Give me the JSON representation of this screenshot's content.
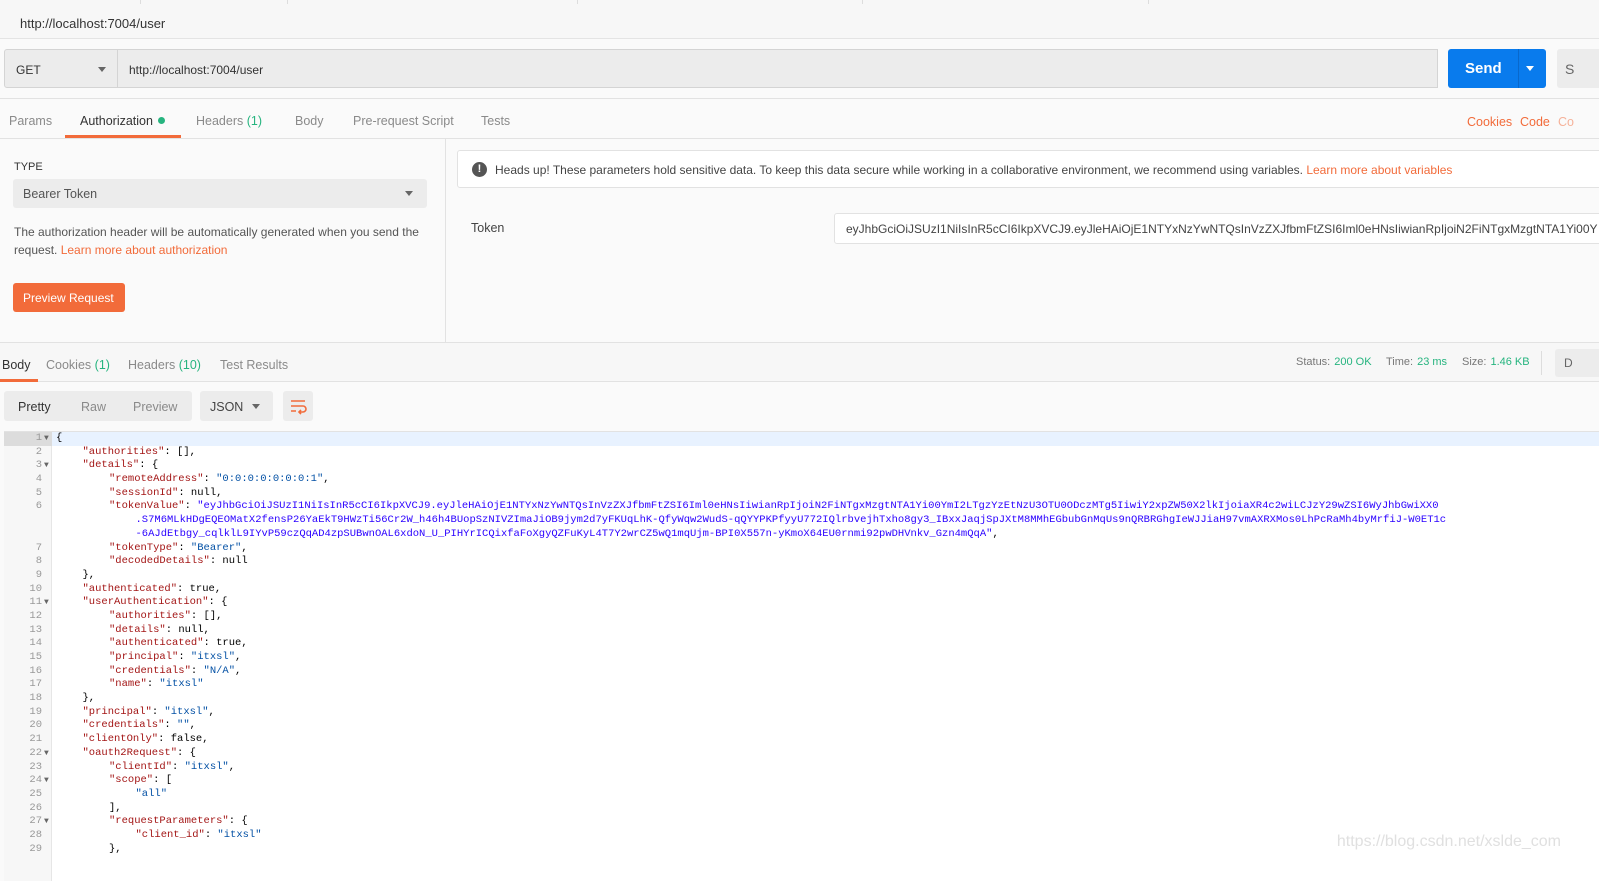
{
  "window": {
    "title": "http://localhost:7004/user"
  },
  "request": {
    "method": "GET",
    "url": "http://localhost:7004/user",
    "send_label": "Send",
    "save_label": "S"
  },
  "request_tabs": [
    {
      "label": "Params"
    },
    {
      "label": "Authorization",
      "active": true,
      "dot": true
    },
    {
      "label": "Headers",
      "count": "(1)"
    },
    {
      "label": "Body"
    },
    {
      "label": "Pre-request Script"
    },
    {
      "label": "Tests"
    }
  ],
  "request_links": {
    "cookies": "Cookies",
    "code": "Code",
    "comments": "Co"
  },
  "auth": {
    "type_label": "TYPE",
    "type_value": "Bearer Token",
    "description": "The authorization header will be automatically generated when you send the request. ",
    "learn_link": "Learn more about authorization",
    "preview_label": "Preview Request",
    "warning": "Heads up! These parameters hold sensitive data. To keep this data secure while working in a collaborative environment, we recommend using variables. ",
    "warning_link": "Learn more about variables",
    "token_label": "Token",
    "token_value": "eyJhbGciOiJSUzI1NiIsInR5cCI6IkpXVCJ9.eyJleHAiOjE1NTYxNzYwNTQsInVzZXJfbmFtZSI6Iml0eHNsIiwianRpIjoiN2FiNTgxMzgtNTA1Yi00Y"
  },
  "response_tabs": [
    {
      "label": "Body",
      "active": true
    },
    {
      "label": "Cookies",
      "count": "(1)"
    },
    {
      "label": "Headers",
      "count": "(10)"
    },
    {
      "label": "Test Results"
    }
  ],
  "response_status": {
    "status_label": "Status:",
    "status": "200 OK",
    "time_label": "Time:",
    "time": "23 ms",
    "size_label": "Size:",
    "size": "1.46 KB",
    "download": "D"
  },
  "body_toolbar": {
    "views": [
      "Pretty",
      "Raw",
      "Preview"
    ],
    "active_view": "Pretty",
    "format": "JSON",
    "colors": {
      "accent": "#f26b3a",
      "success": "#26b47f",
      "send": "#097bed"
    }
  },
  "code": [
    {
      "n": "1",
      "f": true,
      "i": 0,
      "t": [
        [
          "p",
          "{"
        ]
      ]
    },
    {
      "n": "2",
      "i": 1,
      "t": [
        [
          "k",
          "\"authorities\""
        ],
        [
          "p",
          ": [],"
        ]
      ]
    },
    {
      "n": "3",
      "f": true,
      "i": 1,
      "t": [
        [
          "k",
          "\"details\""
        ],
        [
          "p",
          ": {"
        ]
      ]
    },
    {
      "n": "4",
      "i": 2,
      "t": [
        [
          "k",
          "\"remoteAddress\""
        ],
        [
          "p",
          ": "
        ],
        [
          "s",
          "\"0:0:0:0:0:0:0:1\""
        ],
        [
          "p",
          ","
        ]
      ]
    },
    {
      "n": "5",
      "i": 2,
      "t": [
        [
          "k",
          "\"sessionId\""
        ],
        [
          "p",
          ": null,"
        ]
      ]
    },
    {
      "n": "6",
      "i": 2,
      "t": [
        [
          "k",
          "\"tokenValue\""
        ],
        [
          "p",
          ": "
        ],
        [
          "s2",
          "\"eyJhbGciOiJSUzI1NiIsInR5cCI6IkpXVCJ9.eyJleHAiOjE1NTYxNzYwNTQsInVzZXJfbmFtZSI6Iml0eHNsIiwianRpIjoiN2FiNTgxMzgtNTA1Yi00YmI2LTgzYzEtNzU3OTU0ODczMTg5IiwiY2xpZW50X2lkIjoiaXR4c2wiLCJzY29wZSI6WyJhbGwiXX0"
        ]
      ]
    },
    {
      "n": "",
      "i": 3,
      "c": true,
      "t": [
        [
          "s2",
          ".S7M6MLkHDgEQEOMatX2fensP26YaEkT9HWzTi56Cr2W_h46h4BUopSzNIVZImaJiOB9jym2d7yFKUqLhK-QfyWqw2WudS-qQYYPKPfyyU772IQlrbvejhTxho8gy3_IBxxJaqjSpJXtM8MMhEGbubGnMqUs9nQRBRGhgIeWJJiaH97vmAXRXMos0LhPcRaMh4byMrfiJ-W0ET1c"
        ]
      ]
    },
    {
      "n": "",
      "i": 3,
      "c": true,
      "t": [
        [
          "s2",
          "-6AJdEtbgy_cqlklL9IYvP59czQqAD4zpSUBwnOAL6xdoN_U_PIHYrICQixfaFoXgyQZFuKyL4T7Y2wrCZ5wQ1mqUjm-BPI0X557n-yKmoX64EU0rnmi92pwDHVnkv_Gzn4mQqA\""
        ],
        [
          "p",
          ","
        ]
      ]
    },
    {
      "n": "7",
      "i": 2,
      "t": [
        [
          "k",
          "\"tokenType\""
        ],
        [
          "p",
          ": "
        ],
        [
          "s",
          "\"Bearer\""
        ],
        [
          "p",
          ","
        ]
      ]
    },
    {
      "n": "8",
      "i": 2,
      "t": [
        [
          "k",
          "\"decodedDetails\""
        ],
        [
          "p",
          ": null"
        ]
      ]
    },
    {
      "n": "9",
      "i": 1,
      "t": [
        [
          "p",
          "},"
        ]
      ]
    },
    {
      "n": "10",
      "i": 1,
      "t": [
        [
          "k",
          "\"authenticated\""
        ],
        [
          "p",
          ": true,"
        ]
      ]
    },
    {
      "n": "11",
      "f": true,
      "i": 1,
      "t": [
        [
          "k",
          "\"userAuthentication\""
        ],
        [
          "p",
          ": {"
        ]
      ]
    },
    {
      "n": "12",
      "i": 2,
      "t": [
        [
          "k",
          "\"authorities\""
        ],
        [
          "p",
          ": [],"
        ]
      ]
    },
    {
      "n": "13",
      "i": 2,
      "t": [
        [
          "k",
          "\"details\""
        ],
        [
          "p",
          ": null,"
        ]
      ]
    },
    {
      "n": "14",
      "i": 2,
      "t": [
        [
          "k",
          "\"authenticated\""
        ],
        [
          "p",
          ": true,"
        ]
      ]
    },
    {
      "n": "15",
      "i": 2,
      "t": [
        [
          "k",
          "\"principal\""
        ],
        [
          "p",
          ": "
        ],
        [
          "s",
          "\"itxsl\""
        ],
        [
          "p",
          ","
        ]
      ]
    },
    {
      "n": "16",
      "i": 2,
      "t": [
        [
          "k",
          "\"credentials\""
        ],
        [
          "p",
          ": "
        ],
        [
          "s",
          "\"N/A\""
        ],
        [
          "p",
          ","
        ]
      ]
    },
    {
      "n": "17",
      "i": 2,
      "t": [
        [
          "k",
          "\"name\""
        ],
        [
          "p",
          ": "
        ],
        [
          "s",
          "\"itxsl\""
        ]
      ]
    },
    {
      "n": "18",
      "i": 1,
      "t": [
        [
          "p",
          "},"
        ]
      ]
    },
    {
      "n": "19",
      "i": 1,
      "t": [
        [
          "k",
          "\"principal\""
        ],
        [
          "p",
          ": "
        ],
        [
          "s",
          "\"itxsl\""
        ],
        [
          "p",
          ","
        ]
      ]
    },
    {
      "n": "20",
      "i": 1,
      "t": [
        [
          "k",
          "\"credentials\""
        ],
        [
          "p",
          ": "
        ],
        [
          "s",
          "\"\""
        ],
        [
          "p",
          ","
        ]
      ]
    },
    {
      "n": "21",
      "i": 1,
      "t": [
        [
          "k",
          "\"clientOnly\""
        ],
        [
          "p",
          ": false,"
        ]
      ]
    },
    {
      "n": "22",
      "f": true,
      "i": 1,
      "t": [
        [
          "k",
          "\"oauth2Request\""
        ],
        [
          "p",
          ": {"
        ]
      ]
    },
    {
      "n": "23",
      "i": 2,
      "t": [
        [
          "k",
          "\"clientId\""
        ],
        [
          "p",
          ": "
        ],
        [
          "s",
          "\"itxsl\""
        ],
        [
          "p",
          ","
        ]
      ]
    },
    {
      "n": "24",
      "f": true,
      "i": 2,
      "t": [
        [
          "k",
          "\"scope\""
        ],
        [
          "p",
          ": ["
        ]
      ]
    },
    {
      "n": "25",
      "i": 3,
      "t": [
        [
          "s",
          "\"all\""
        ]
      ]
    },
    {
      "n": "26",
      "i": 2,
      "t": [
        [
          "p",
          "],"
        ]
      ]
    },
    {
      "n": "27",
      "f": true,
      "i": 2,
      "t": [
        [
          "k",
          "\"requestParameters\""
        ],
        [
          "p",
          ": {"
        ]
      ]
    },
    {
      "n": "28",
      "i": 3,
      "t": [
        [
          "k",
          "\"client_id\""
        ],
        [
          "p",
          ": "
        ],
        [
          "s",
          "\"itxsl\""
        ]
      ]
    },
    {
      "n": "29",
      "i": 2,
      "t": [
        [
          "p",
          "},"
        ]
      ]
    }
  ],
  "watermark": "https://blog.csdn.net/xslde_com"
}
